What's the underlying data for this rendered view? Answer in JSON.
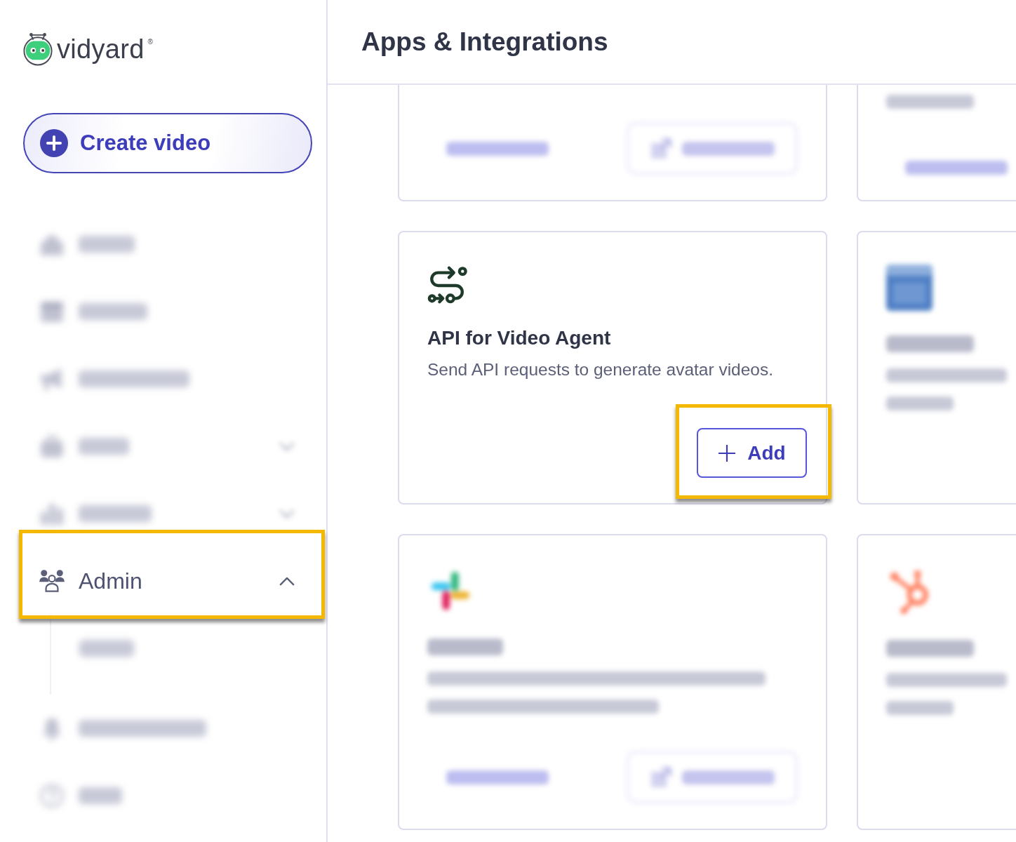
{
  "sidebar": {
    "logo": {
      "wordmark": "vidyard",
      "registered_mark": "®"
    },
    "create_button": {
      "label": "Create video"
    },
    "nav": [
      {
        "kind": "link",
        "blurred": true,
        "highlighted": false
      },
      {
        "kind": "link",
        "blurred": true,
        "highlighted": false
      },
      {
        "kind": "link",
        "blurred": true,
        "highlighted": false
      },
      {
        "kind": "group",
        "expanded": false,
        "blurred": true,
        "highlighted": false
      },
      {
        "kind": "group",
        "expanded": false,
        "blurred": true,
        "highlighted": false
      },
      {
        "kind": "group",
        "label": "Admin",
        "expanded": true,
        "blurred": false,
        "highlighted": true,
        "children": [
          {
            "kind": "link",
            "blurred": true,
            "highlighted": false
          }
        ]
      },
      {
        "kind": "link",
        "blurred": true,
        "highlighted": false
      },
      {
        "kind": "link",
        "blurred": true,
        "highlighted": false
      }
    ]
  },
  "main": {
    "title": "Apps & Integrations",
    "cards": [
      {
        "cut_off_top": true,
        "blurred": true,
        "actions": [
          {
            "kind": "link",
            "highlighted": false
          },
          {
            "kind": "button",
            "highlighted": false
          }
        ]
      },
      {
        "cut_off_top": true,
        "blurred": true,
        "blocks": [
          {
            "kind": "line"
          }
        ],
        "actions": [
          {
            "kind": "link",
            "highlighted": false
          }
        ]
      },
      {
        "cut_off_top": false,
        "blurred": false,
        "title": "API for Video Agent",
        "description": "Send API requests to generate avatar videos.",
        "actions": [
          {
            "kind": "add",
            "label": "Add",
            "highlighted": true
          }
        ]
      },
      {
        "cut_off_top": false,
        "blurred": true,
        "blocks": [
          {
            "kind": "title"
          },
          {
            "kind": "line"
          },
          {
            "kind": "line"
          }
        ]
      },
      {
        "cut_off_top": false,
        "blurred": true,
        "blocks": [
          {
            "kind": "title"
          },
          {
            "kind": "line"
          },
          {
            "kind": "line"
          }
        ],
        "actions": [
          {
            "kind": "link",
            "highlighted": false
          },
          {
            "kind": "button",
            "highlighted": false
          }
        ]
      },
      {
        "cut_off_top": false,
        "blurred": true,
        "blocks": [
          {
            "kind": "title"
          },
          {
            "kind": "line"
          },
          {
            "kind": "line"
          }
        ]
      }
    ]
  }
}
